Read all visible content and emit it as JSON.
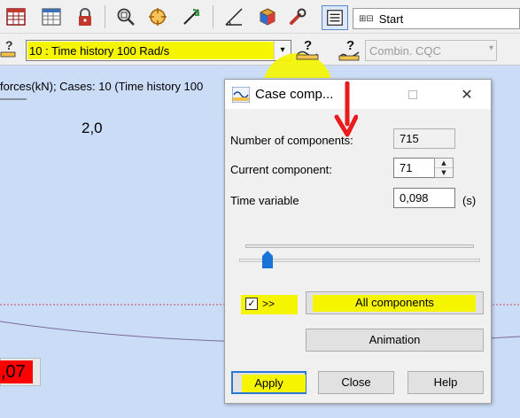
{
  "toolbar_top": {
    "icons": [
      "table-icon",
      "table-grid-icon",
      "lock-icon",
      "zoom-window-icon",
      "zoom-extents-icon",
      "refresh-arrows-icon",
      "dimension-ruler-icon",
      "3d-box-icon",
      "wrench-icon",
      "view-list-icon"
    ],
    "start_label": "Start"
  },
  "toolbar_second": {
    "case_selected": "10 : Time history 100 Rad/s",
    "combination_selected": "Combin. CQC"
  },
  "canvas": {
    "status_text": "forces(kN); Cases: 10 (Time history 100",
    "axis_label": "2,0",
    "red_value": ",07"
  },
  "dialog": {
    "title": "Case comp...",
    "number_of_components_label": "Number of components:",
    "number_of_components_value": "715",
    "current_component_label": "Current component:",
    "current_component_value": "71",
    "time_variable_label": "Time variable",
    "time_variable_value": "0,098",
    "time_unit": "(s)",
    "checkbox_label": ">>",
    "checkbox_checked": true,
    "all_components_label": "All components",
    "animation_label": "Animation",
    "apply_label": "Apply",
    "close_label": "Close",
    "help_label": "Help"
  },
  "colors": {
    "highlight": "#f5f500",
    "canvas_bg": "#cbdcf7",
    "arrow_red": "#e81c1c",
    "value_red": "#ff0000",
    "slider_blue": "#1a73d9"
  }
}
